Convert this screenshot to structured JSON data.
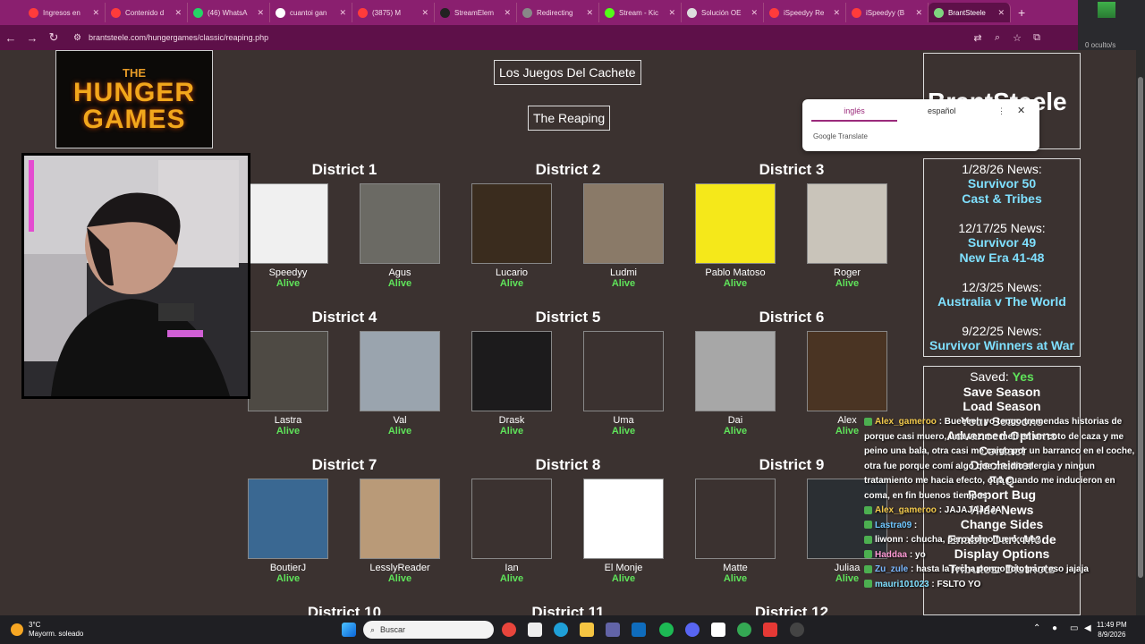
{
  "tabs": [
    {
      "label": "Ingresos en",
      "color": "#ff3b3b"
    },
    {
      "label": "Contenido d",
      "color": "#ff3b3b"
    },
    {
      "label": "(46) WhatsA",
      "color": "#25d366"
    },
    {
      "label": "cuantoi gan",
      "color": "#ffffff"
    },
    {
      "label": "(3875) M",
      "color": "#ff3b3b"
    },
    {
      "label": "StreamElem",
      "color": "#222222"
    },
    {
      "label": "Redirecting",
      "color": "#888888"
    },
    {
      "label": "Stream - Kic",
      "color": "#53fc18"
    },
    {
      "label": "Solución OE",
      "color": "#dddddd"
    },
    {
      "label": "iSpeedyy Re",
      "color": "#ff3b3b"
    },
    {
      "label": "iSpeedyy (B",
      "color": "#ff3b3b"
    },
    {
      "label": "BrantSteele",
      "color": "#7fd47f",
      "active": true
    }
  ],
  "address": {
    "url": "brantsteele.com/hungergames/classic/reaping.php"
  },
  "obs": {
    "hidden": "0 oculto/s"
  },
  "translate": {
    "lang_from": "inglés",
    "lang_to": "español",
    "brand": "Google Translate"
  },
  "logo": {
    "the": "THE",
    "line1": "HUNGER",
    "line2": "GAMES"
  },
  "page": {
    "title": "Los Juegos Del Cachete",
    "subtitle": "The Reaping"
  },
  "districts": [
    {
      "name": "District 1",
      "tributes": [
        {
          "name": "Speedyy",
          "status": "Alive",
          "bg": "#f0f0f0"
        },
        {
          "name": "Agus",
          "status": "Alive",
          "bg": "#6b6a64"
        }
      ]
    },
    {
      "name": "District 2",
      "tributes": [
        {
          "name": "Lucario",
          "status": "Alive",
          "bg": "#3a2c1e"
        },
        {
          "name": "Ludmi",
          "status": "Alive",
          "bg": "#8a7a68"
        }
      ]
    },
    {
      "name": "District 3",
      "tributes": [
        {
          "name": "Pablo Matoso",
          "status": "Alive",
          "bg": "#f5e81a"
        },
        {
          "name": "Roger",
          "status": "Alive",
          "bg": "#c9c4ba"
        }
      ]
    },
    {
      "name": "District 4",
      "tributes": [
        {
          "name": "Lastra",
          "status": "Alive",
          "bg": "#4e4a44"
        },
        {
          "name": "Val",
          "status": "Alive",
          "bg": "#9aa4ae"
        }
      ]
    },
    {
      "name": "District 5",
      "tributes": [
        {
          "name": "Drask",
          "status": "Alive",
          "bg": "#1c1b1c"
        },
        {
          "name": "Uma",
          "status": "Alive",
          "bg": "#3b3230"
        }
      ]
    },
    {
      "name": "District 6",
      "tributes": [
        {
          "name": "Dai",
          "status": "Alive",
          "bg": "#a7a7a7"
        },
        {
          "name": "Alex",
          "status": "Alive",
          "bg": "#4a3423"
        }
      ]
    },
    {
      "name": "District 7",
      "tributes": [
        {
          "name": "BoutierJ",
          "status": "Alive",
          "bg": "#3a6892"
        },
        {
          "name": "LesslyReader",
          "status": "Alive",
          "bg": "#b99a78"
        }
      ]
    },
    {
      "name": "District 8",
      "tributes": [
        {
          "name": "Ian",
          "status": "Alive",
          "bg": "#3b3230"
        },
        {
          "name": "El Monje",
          "status": "Alive",
          "bg": "#ffffff"
        }
      ]
    },
    {
      "name": "District 9",
      "tributes": [
        {
          "name": "Matte",
          "status": "Alive",
          "bg": "#3b3230"
        },
        {
          "name": "Juliaa",
          "status": "Alive",
          "bg": "#2b2f33"
        }
      ]
    },
    {
      "name": "District 10"
    },
    {
      "name": "District 11"
    },
    {
      "name": "District 12"
    }
  ],
  "sidebar": {
    "brand": "BrantSteele",
    "news": [
      {
        "date": "1/28/26 News:",
        "links": [
          "Survivor 50",
          "Cast & Tribes"
        ]
      },
      {
        "date": "12/17/25 News:",
        "links": [
          "Survivor 49",
          "New Era 41-48"
        ]
      },
      {
        "date": "12/3/25 News:",
        "links": [
          "Australia v The World"
        ]
      },
      {
        "date": "9/22/25 News:",
        "links": [
          "Survivor Winners at War"
        ]
      }
    ],
    "saved_label": "Saved:",
    "saved_value": "Yes",
    "options": [
      "Save Season",
      "Load Season",
      "Your Seasons",
      "Advanced Options",
      "Contact",
      "Disclaimer",
      "FAQ",
      "Report Bug",
      "Hide News",
      "Change Sides",
      "Enable Dark Mode",
      "Display Options",
      "Tributes: Districts"
    ]
  },
  "chat": [
    {
      "user": "Alex_gameroo",
      "user_color": "#f2c94c",
      "text": ": Bueeeeh yo tengo tremendas historias de porque casi muero, una vez me metí en un coto de caza y me peino una bala, otra casi me caigo por un barranco en el coche, otra fue porque comí algo que me dio alergia y ningun tratamiento me hacia efecto, otra cuando me inducieron en coma, en fin buenos tiempos"
    },
    {
      "user": "Alex_gameroo",
      "user_color": "#f2c94c",
      "text": ": JAJAJAJAJA"
    },
    {
      "user": "Lastra09",
      "user_color": "#6ec6ff",
      "text": ":"
    },
    {
      "user": "liwonn",
      "user_color": "#ffffff",
      "text": ": chucha, pero como fue o que?"
    },
    {
      "user": "Haddaa",
      "user_color": "#ff9ad5",
      "text": ": yo"
    },
    {
      "user": "Zu_zule",
      "user_color": "#7ab8ff",
      "text": ": hasta la fecha pongo foto para eso jajaja"
    },
    {
      "user": "mauri101023",
      "user_color": "#7fe0ff",
      "text": ": FSLTO YO"
    }
  ],
  "taskbar": {
    "temp": "3°C",
    "weather": "Mayorm. soleado",
    "search": "Buscar",
    "time": "11:49 PM",
    "date": "8/9/2026"
  }
}
